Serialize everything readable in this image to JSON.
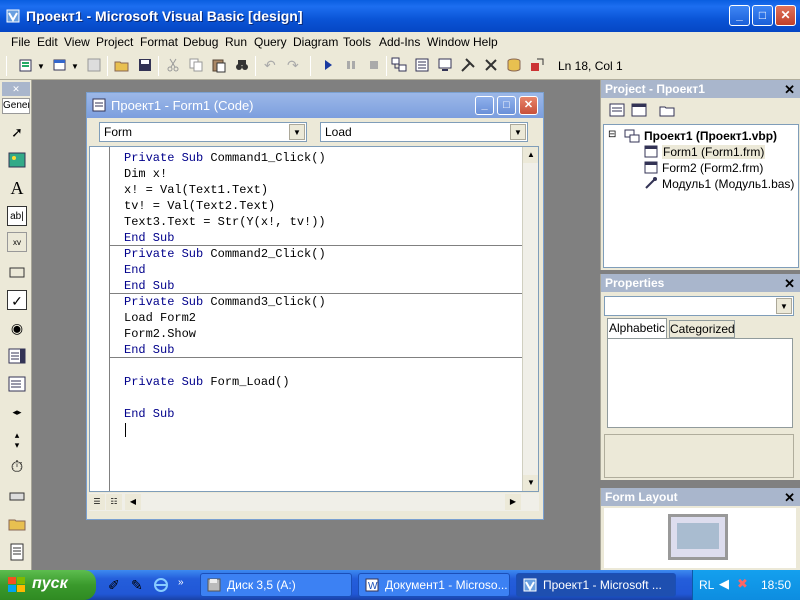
{
  "app": {
    "title": "Проект1 - Microsoft Visual Basic [design]",
    "min_label": "_",
    "max_label": "□",
    "close_label": "✕"
  },
  "menu": [
    "File",
    "Edit",
    "View",
    "Project",
    "Format",
    "Debug",
    "Run",
    "Query",
    "Diagram",
    "Tools",
    "Add-Ins",
    "Window",
    "Help"
  ],
  "toolbar": {
    "position": "Ln 18, Col 1"
  },
  "toolbox": {
    "tab_label": "General"
  },
  "codewin": {
    "title": "Проект1 - Form1 (Code)",
    "object_combo": "Form",
    "proc_combo": "Load"
  },
  "code": [
    "Private Sub Command1_Click()",
    "Dim x!",
    "x! = Val(Text1.Text)",
    "tv! = Val(Text2.Text)",
    "Text3.Text = Str(Y(x!, tv!))",
    "End Sub",
    "Private Sub Command2_Click()",
    "End",
    "End Sub",
    "Private Sub Command3_Click()",
    "Load Form2",
    "Form2.Show",
    "End Sub",
    "",
    "Private Sub Form_Load()",
    "",
    "End Sub"
  ],
  "project": {
    "title": "Project - Проект1",
    "root": "Проект1 (Проект1.vbp)",
    "items": [
      "Form1 (Form1.frm)",
      "Form2 (Form2.frm)",
      "Модуль1 (Модуль1.bas)"
    ]
  },
  "properties": {
    "title": "Properties",
    "tabs": [
      "Alphabetic",
      "Categorized"
    ]
  },
  "form_layout": {
    "title": "Form Layout"
  },
  "taskbar": {
    "start": "пуск",
    "tasks": [
      "Диск 3,5 (A:)",
      "Документ1 - Microso...",
      "Проект1 - Microsoft ..."
    ],
    "lang": "RL",
    "clock": "18:50"
  }
}
